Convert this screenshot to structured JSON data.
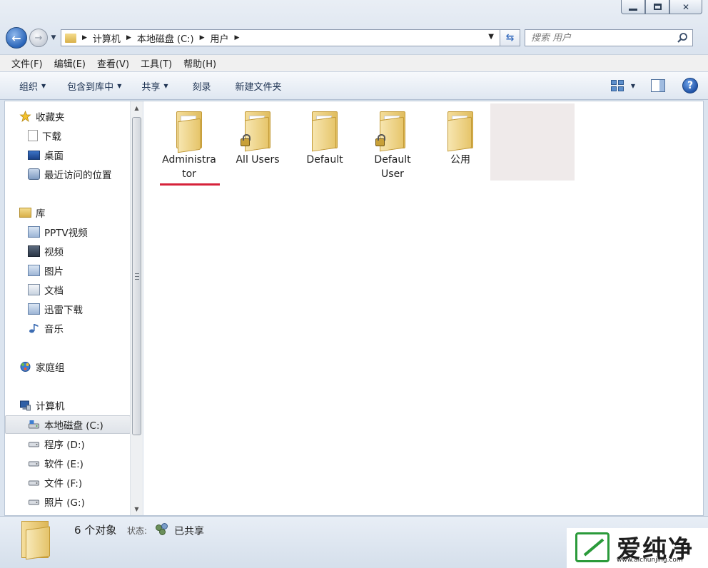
{
  "window": {
    "controls": [
      "minimize",
      "maximize",
      "close"
    ]
  },
  "address": {
    "crumbs": [
      "计算机",
      "本地磁盘 (C:)",
      "用户"
    ],
    "search_placeholder": "搜索 用户"
  },
  "menubar": {
    "items": [
      "文件(F)",
      "编辑(E)",
      "查看(V)",
      "工具(T)",
      "帮助(H)"
    ]
  },
  "toolbar": {
    "organize": "组织",
    "include_in_library": "包含到库中",
    "share": "共享",
    "burn": "刻录",
    "new_folder": "新建文件夹"
  },
  "nav": {
    "favorites": "收藏夹",
    "downloads": "下载",
    "desktop": "桌面",
    "recent": "最近访问的位置",
    "libraries": "库",
    "pptv": "PPTV视频",
    "videos": "视频",
    "pictures": "图片",
    "documents": "文档",
    "xunlei": "迅雷下载",
    "music": "音乐",
    "homegroup": "家庭组",
    "computer": "计算机",
    "drive_c": "本地磁盘 (C:)",
    "drive_d": "程序 (D:)",
    "drive_e": "软件 (E:)",
    "drive_f": "文件 (F:)",
    "drive_g": "照片 (G:)"
  },
  "files": [
    {
      "line1": "Administra",
      "line2": "tor",
      "locked": false
    },
    {
      "line1": "All Users",
      "line2": "",
      "locked": true
    },
    {
      "line1": "Default",
      "line2": "",
      "locked": false
    },
    {
      "line1": "Default",
      "line2": "User",
      "locked": true
    },
    {
      "line1": "公用",
      "line2": "",
      "locked": false
    }
  ],
  "status": {
    "count": "6 个对象",
    "state_label": "状态:",
    "state_value": "已共享"
  },
  "watermark": {
    "title": "爱纯净",
    "url": "www.aichunjing.com"
  },
  "colors": {
    "highlight": "#d6223a",
    "folder": "#e6c56b",
    "accent": "#2a65b9"
  }
}
